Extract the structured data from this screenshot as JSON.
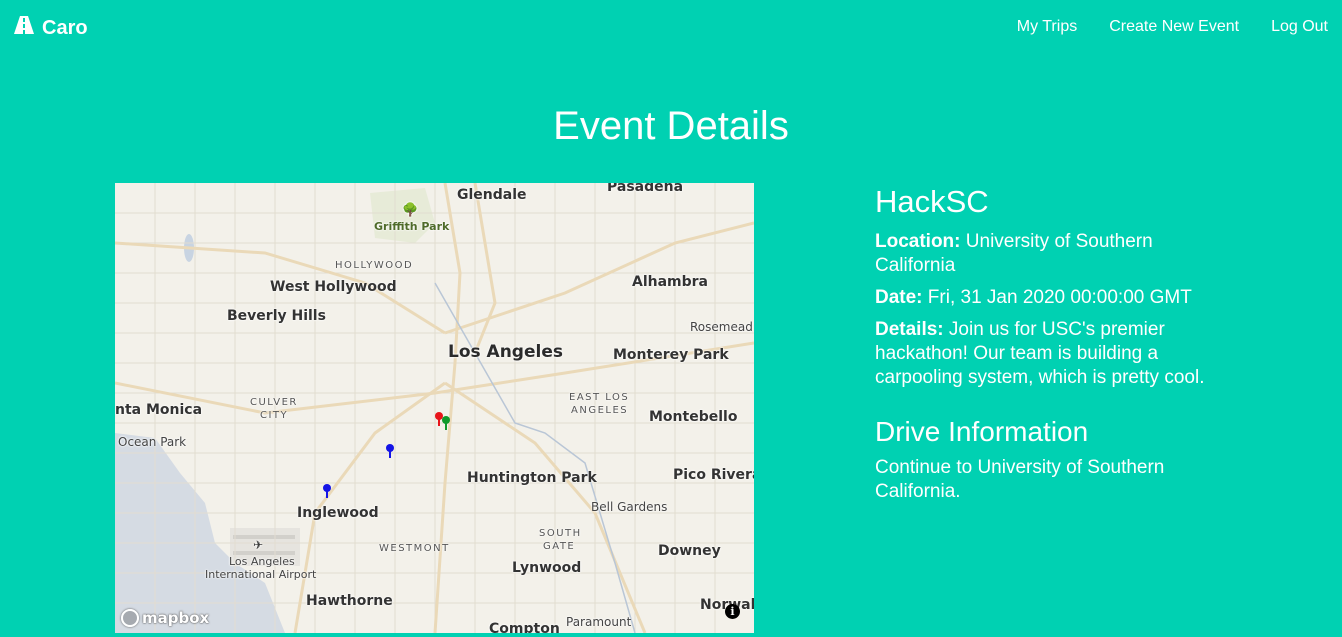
{
  "nav": {
    "brand": "Caro",
    "brand_icon": "road-icon",
    "links": [
      "My Trips",
      "Create New Event",
      "Log Out"
    ]
  },
  "page_title": "Event Details",
  "map": {
    "labels": {
      "glendale": "Glendale",
      "pasadena": "Pasadena",
      "griffith": "Griffith Park",
      "hollywood": "HOLLYWOOD",
      "west_hollywood": "West Hollywood",
      "alhambra": "Alhambra",
      "beverly_hills": "Beverly Hills",
      "rosemead": "Rosemead",
      "los_angeles": "Los Angeles",
      "monterey_park": "Monterey Park",
      "culver": "CULVER",
      "city": "CITY",
      "east": "EAST LOS",
      "angeles": "ANGELES",
      "santa_monica": "nta Monica",
      "montebello": "Montebello",
      "ocean_park": "Ocean Park",
      "huntington_park": "Huntington Park",
      "pico_rivera": "Pico Rivera",
      "bell_gardens": "Bell Gardens",
      "inglewood": "Inglewood",
      "south": "SOUTH",
      "gate": "GATE",
      "westmont": "WESTMONT",
      "downey": "Downey",
      "lax1": "Los Angeles",
      "lax2": "International Airport",
      "lynwood": "Lynwood",
      "hawthorne": "Hawthorne",
      "norwalk": "Norwalk",
      "compton": "Compton",
      "paramount": "Paramount"
    },
    "attribution": "mapbox",
    "info_icon": "info-icon",
    "colors": {
      "red_pin": "#e8141a",
      "green_pin": "#0f9a2c",
      "blue_pin": "#1414e6"
    }
  },
  "event": {
    "name": "HackSC",
    "location_label": "Location:",
    "location": "University of Southern California",
    "date_label": "Date:",
    "date": "Fri, 31 Jan 2020 00:00:00 GMT",
    "details_label": "Details:",
    "details": "Join us for USC's premier hackathon! Our team is building a carpooling system, which is pretty cool."
  },
  "drive": {
    "heading": "Drive Information",
    "text": "Continue to University of Southern California."
  }
}
